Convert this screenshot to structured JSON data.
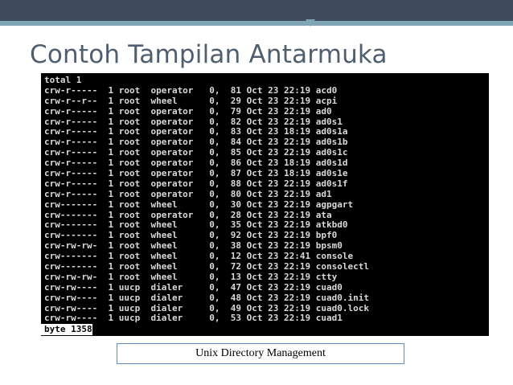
{
  "slide": {
    "title": "Contoh Tampilan Antarmuka",
    "caption": "Unix Directory Management"
  },
  "terminal": {
    "lines": [
      "total 1",
      "crw-r-----  1 root  operator   0,  81 Oct 23 22:19 acd0",
      "crw-r--r--  1 root  wheel      0,  29 Oct 23 22:19 acpi",
      "crw-r-----  1 root  operator   0,  79 Oct 23 22:19 ad0",
      "crw-r-----  1 root  operator   0,  82 Oct 23 22:19 ad0s1",
      "crw-r-----  1 root  operator   0,  83 Oct 23 18:19 ad0s1a",
      "crw-r-----  1 root  operator   0,  84 Oct 23 22:19 ad0s1b",
      "crw-r-----  1 root  operator   0,  85 Oct 23 22:19 ad0s1c",
      "crw-r-----  1 root  operator   0,  86 Oct 23 18:19 ad0s1d",
      "crw-r-----  1 root  operator   0,  87 Oct 23 18:19 ad0s1e",
      "crw-r-----  1 root  operator   0,  88 Oct 23 22:19 ad0s1f",
      "crw-r-----  1 root  operator   0,  80 Oct 23 22:19 ad1",
      "crw-------  1 root  wheel      0,  30 Oct 23 22:19 agpgart",
      "crw-------  1 root  operator   0,  28 Oct 23 22:19 ata",
      "crw-------  1 root  wheel      0,  35 Oct 23 22:19 atkbd0",
      "crw-------  1 root  wheel      0,  92 Oct 23 22:19 bpf0",
      "crw-rw-rw-  1 root  wheel      0,  38 Oct 23 22:19 bpsm0",
      "crw-------  1 root  wheel      0,  12 Oct 23 22:41 console",
      "crw-------  1 root  wheel      0,  72 Oct 23 22:19 consolectl",
      "crw-rw-rw-  1 root  wheel      0,  13 Oct 23 22:19 ctty",
      "crw-rw----  1 uucp  dialer     0,  47 Oct 23 22:19 cuad0",
      "crw-rw----  1 uucp  dialer     0,  48 Oct 23 22:19 cuad0.init",
      "crw-rw----  1 uucp  dialer     0,  49 Oct 23 22:19 cuad0.lock",
      "crw-rw----  1 uucp  dialer     0,  53 Oct 23 22:19 cuad1"
    ],
    "footer": "byte 1358"
  },
  "colors": {
    "header_dark": "#3f4a5a",
    "header_accent": "#7fa5b7",
    "title_text": "#4f5f6f",
    "terminal_bg": "#000000",
    "terminal_text": "#d9d9d9",
    "caption_border": "#5b8db8"
  }
}
